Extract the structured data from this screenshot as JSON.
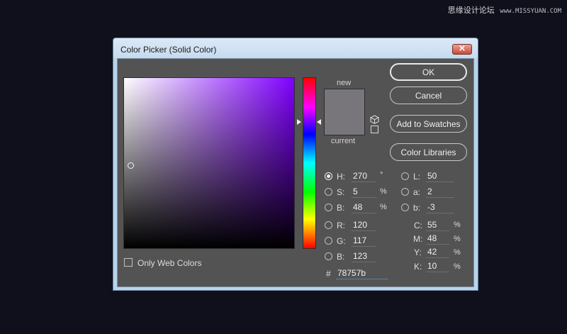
{
  "watermark": {
    "cn": "思缘设计论坛",
    "url": "www.MISSYUAN.COM"
  },
  "window": {
    "title": "Color Picker (Solid Color)",
    "close_glyph": "×"
  },
  "swatch": {
    "new_label": "new",
    "current_label": "current",
    "new_color": "#78757b",
    "current_color": "#78757b"
  },
  "buttons": {
    "ok": "OK",
    "cancel": "Cancel",
    "add_to_swatches": "Add to Swatches",
    "color_libraries": "Color Libraries"
  },
  "hsb": {
    "h": {
      "label": "H:",
      "value": "270",
      "unit": "°"
    },
    "s": {
      "label": "S:",
      "value": "5",
      "unit": "%"
    },
    "b": {
      "label": "B:",
      "value": "48",
      "unit": "%"
    }
  },
  "rgb": {
    "r": {
      "label": "R:",
      "value": "120"
    },
    "g": {
      "label": "G:",
      "value": "117"
    },
    "b": {
      "label": "B:",
      "value": "123"
    }
  },
  "lab": {
    "l": {
      "label": "L:",
      "value": "50"
    },
    "a": {
      "label": "a:",
      "value": "2"
    },
    "b": {
      "label": "b:",
      "value": "-3"
    }
  },
  "cmyk": {
    "c": {
      "label": "C:",
      "value": "55",
      "unit": "%"
    },
    "m": {
      "label": "M:",
      "value": "48",
      "unit": "%"
    },
    "y": {
      "label": "Y:",
      "value": "42",
      "unit": "%"
    },
    "k": {
      "label": "K:",
      "value": "10",
      "unit": "%"
    }
  },
  "hex": {
    "label": "#",
    "value": "78757b"
  },
  "only_web_colors": {
    "label": "Only Web Colors",
    "checked": false
  },
  "selected_mode": "H",
  "colors": {
    "hue_base": "#8000ff"
  }
}
